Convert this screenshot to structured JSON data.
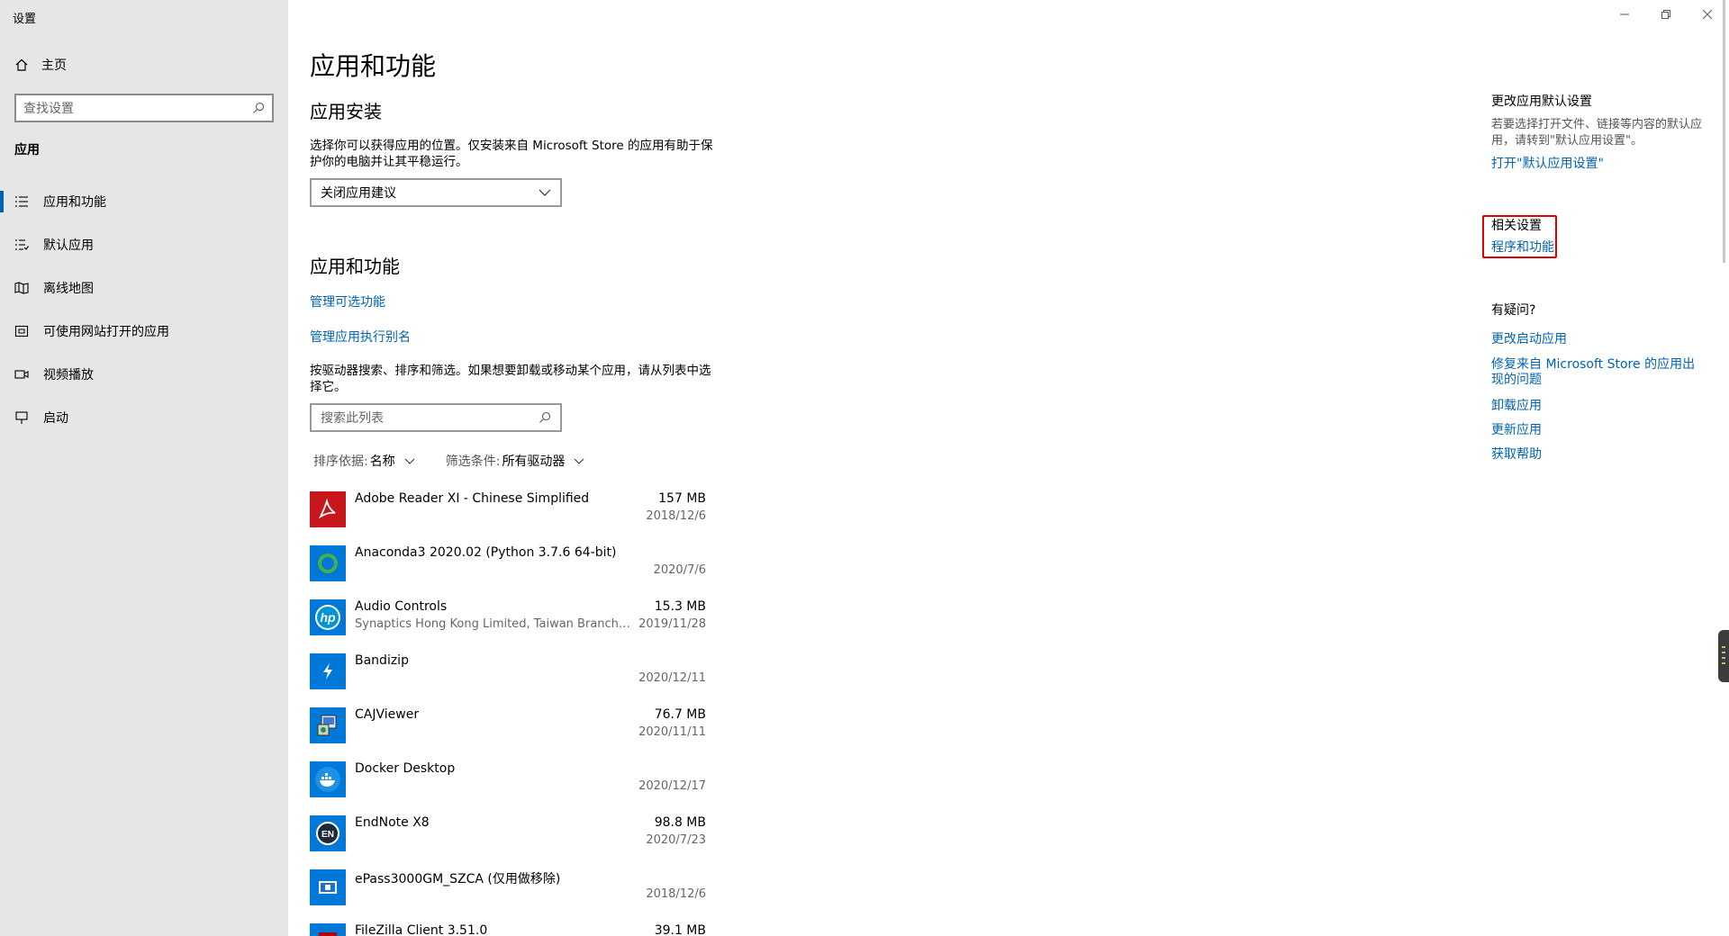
{
  "window": {
    "title": "设置"
  },
  "sidebar": {
    "home": "主页",
    "search_placeholder": "查找设置",
    "section": "应用",
    "items": [
      {
        "label": "应用和功能",
        "icon": "list-icon"
      },
      {
        "label": "默认应用",
        "icon": "default-list-icon"
      },
      {
        "label": "离线地图",
        "icon": "map-icon"
      },
      {
        "label": "可使用网站打开的应用",
        "icon": "website-app-icon"
      },
      {
        "label": "视频播放",
        "icon": "video-icon"
      },
      {
        "label": "启动",
        "icon": "startup-icon"
      }
    ]
  },
  "main": {
    "title": "应用和功能",
    "install": {
      "heading": "应用安装",
      "desc": "选择你可以获得应用的位置。仅安装来自 Microsoft Store 的应用有助于保护你的电脑并让其平稳运行。",
      "dropdown_value": "关闭应用建议"
    },
    "apps": {
      "heading": "应用和功能",
      "link_optional": "管理可选功能",
      "link_alias": "管理应用执行别名",
      "desc": "按驱动器搜索、排序和筛选。如果想要卸载或移动某个应用，请从列表中选择它。",
      "search_placeholder": "搜索此列表",
      "sort_label": "排序依据:",
      "sort_value": "名称",
      "filter_label": "筛选条件:",
      "filter_value": "所有驱动器"
    },
    "list": [
      {
        "name": "Adobe Reader XI - Chinese Simplified",
        "publisher": "",
        "size": "157 MB",
        "date": "2018/12/6",
        "icon": "adobe-reader-icon",
        "color": "#c8161d"
      },
      {
        "name": "Anaconda3 2020.02 (Python 3.7.6 64-bit)",
        "publisher": "",
        "size": "",
        "date": "2020/7/6",
        "icon": "anaconda-icon",
        "color": "#0078d7"
      },
      {
        "name": "Audio Controls",
        "publisher": "Synaptics Hong Kong Limited, Taiwan Branch (H....",
        "size": "15.3 MB",
        "date": "2019/11/28",
        "icon": "hp-icon",
        "color": "#0078d7"
      },
      {
        "name": "Bandizip",
        "publisher": "",
        "size": "",
        "date": "2020/12/11",
        "icon": "bandizip-icon",
        "color": "#0078d7"
      },
      {
        "name": "CAJViewer",
        "publisher": "",
        "size": "76.7 MB",
        "date": "2020/11/11",
        "icon": "cajviewer-icon",
        "color": "#0078d7"
      },
      {
        "name": "Docker Desktop",
        "publisher": "",
        "size": "",
        "date": "2020/12/17",
        "icon": "docker-icon",
        "color": "#0078d7"
      },
      {
        "name": "EndNote X8",
        "publisher": "",
        "size": "98.8 MB",
        "date": "2020/7/23",
        "icon": "endnote-icon",
        "color": "#0078d7"
      },
      {
        "name": "ePass3000GM_SZCA (仅用做移除)",
        "publisher": "",
        "size": "",
        "date": "2018/12/6",
        "icon": "epass-icon",
        "color": "#0078d7"
      },
      {
        "name": "FileZilla Client 3.51.0",
        "publisher": "",
        "size": "39.1 MB",
        "date": "",
        "icon": "filezilla-icon",
        "color": "#0078d7"
      }
    ]
  },
  "right": {
    "default_heading": "更改应用默认设置",
    "default_desc": "若要选择打开文件、链接等内容的默认应用，请转到\"默认应用设置\"。",
    "default_link": "打开\"默认应用设置\"",
    "related_heading": "相关设置",
    "related_link": "程序和功能",
    "help_heading": "有疑问?",
    "help_links": [
      "更改启动应用",
      "修复来自 Microsoft Store 的应用出现的问题",
      "卸载应用",
      "更新应用",
      "获取帮助"
    ]
  },
  "colors": {
    "accent": "#0063b1",
    "sidebar_bg": "#e6e6e6",
    "highlight": "#e00000"
  }
}
